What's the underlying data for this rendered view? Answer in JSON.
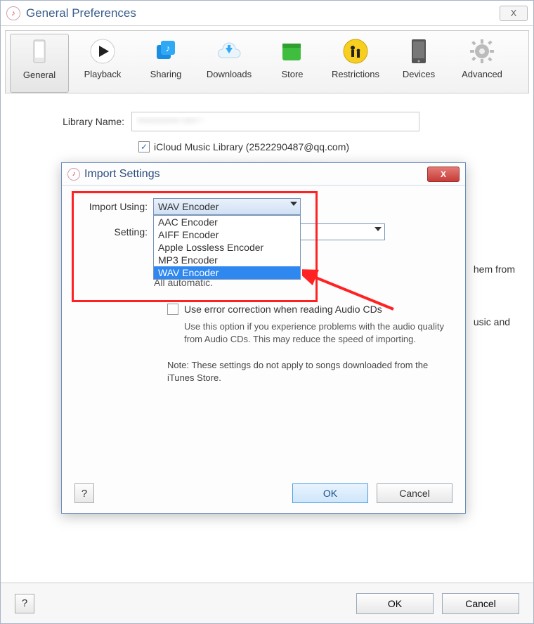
{
  "window": {
    "title": "General Preferences",
    "close_glyph": "X"
  },
  "toolbar": {
    "items": [
      {
        "label": "General",
        "icon": "phone-icon"
      },
      {
        "label": "Playback",
        "icon": "play-icon"
      },
      {
        "label": "Sharing",
        "icon": "share-icon"
      },
      {
        "label": "Downloads",
        "icon": "download-icon"
      },
      {
        "label": "Store",
        "icon": "store-icon"
      },
      {
        "label": "Restrictions",
        "icon": "restrictions-icon"
      },
      {
        "label": "Devices",
        "icon": "device-icon"
      },
      {
        "label": "Advanced",
        "icon": "gear-icon"
      }
    ],
    "selected_index": 0
  },
  "pref": {
    "library_name_label": "Library Name:",
    "library_name_value": "“*********** **** ”",
    "icloud_checked": true,
    "icloud_label": "iCloud Music Library (2522290487@qq.com)",
    "blur_text": "*** *** **** ***** ***** **** *** ******* * ***** **",
    "trunc1": "hem from",
    "trunc2": "usic and"
  },
  "modal": {
    "title": "Import Settings",
    "close_glyph": "X",
    "import_label": "Import Using:",
    "import_selected": "WAV Encoder",
    "options": [
      "AAC Encoder",
      "AIFF Encoder",
      "Apple Lossless Encoder",
      "MP3 Encoder",
      "WAV Encoder"
    ],
    "selected_option_index": 4,
    "setting_label": "Setting:",
    "setting_value": "",
    "ghost_line": "All automatic.",
    "error_chk_label": "Use error correction when reading Audio CDs",
    "error_chk_checked": false,
    "error_note": "Use this option if you experience problems with the audio quality from Audio CDs. This may reduce the speed of importing.",
    "store_note": "Note: These settings do not apply to songs downloaded from the iTunes Store.",
    "help_label": "?",
    "ok": "OK",
    "cancel": "Cancel"
  },
  "bottom": {
    "help_label": "?",
    "ok": "OK",
    "cancel": "Cancel"
  },
  "colors": {
    "accent": "#2f87f0",
    "annotation": "#f22222"
  }
}
